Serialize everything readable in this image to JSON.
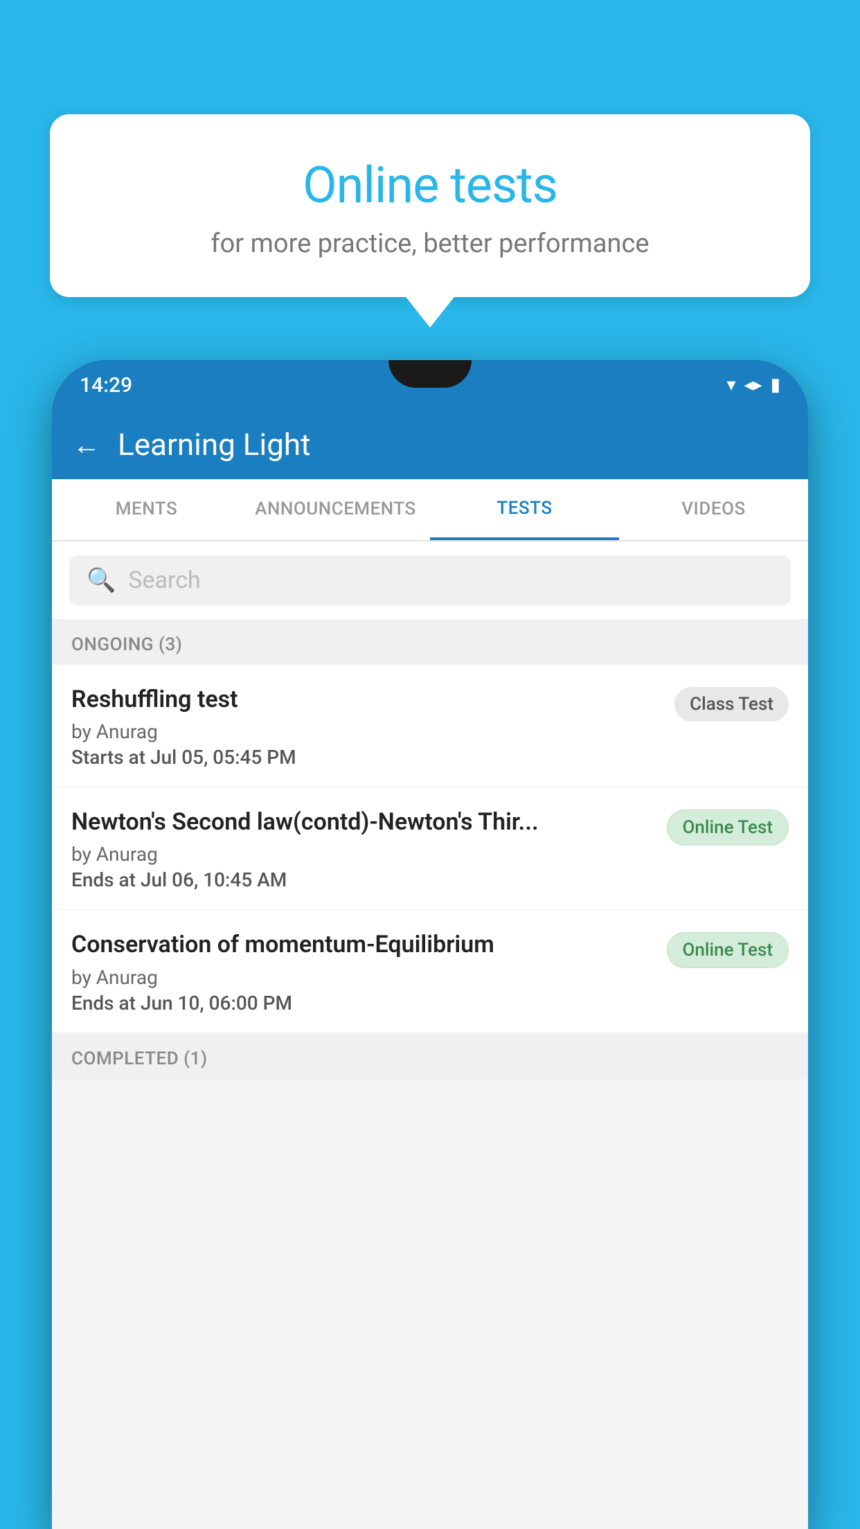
{
  "background_color": "#29b6e8",
  "speech_bubble": {
    "title": "Online tests",
    "subtitle": "for more practice, better performance"
  },
  "phone": {
    "status_bar": {
      "time": "14:29",
      "wifi": "▾▾",
      "signal": "▲▲",
      "battery": "▮"
    },
    "header": {
      "back_label": "←",
      "title": "Learning Light"
    },
    "tabs": [
      {
        "label": "MENTS",
        "active": false
      },
      {
        "label": "ANNOUNCEMENTS",
        "active": false
      },
      {
        "label": "TESTS",
        "active": true
      },
      {
        "label": "VIDEOS",
        "active": false
      }
    ],
    "search": {
      "placeholder": "Search"
    },
    "ongoing_section": {
      "label": "ONGOING (3)",
      "tests": [
        {
          "name": "Reshuffling test",
          "by": "by Anurag",
          "date_label": "Starts at",
          "date": "Jul 05, 05:45 PM",
          "badge": "Class Test",
          "badge_type": "class"
        },
        {
          "name": "Newton's Second law(contd)-Newton's Thir...",
          "by": "by Anurag",
          "date_label": "Ends at",
          "date": "Jul 06, 10:45 AM",
          "badge": "Online Test",
          "badge_type": "online"
        },
        {
          "name": "Conservation of momentum-Equilibrium",
          "by": "by Anurag",
          "date_label": "Ends at",
          "date": "Jun 10, 06:00 PM",
          "badge": "Online Test",
          "badge_type": "online"
        }
      ]
    },
    "completed_section": {
      "label": "COMPLETED (1)"
    }
  }
}
